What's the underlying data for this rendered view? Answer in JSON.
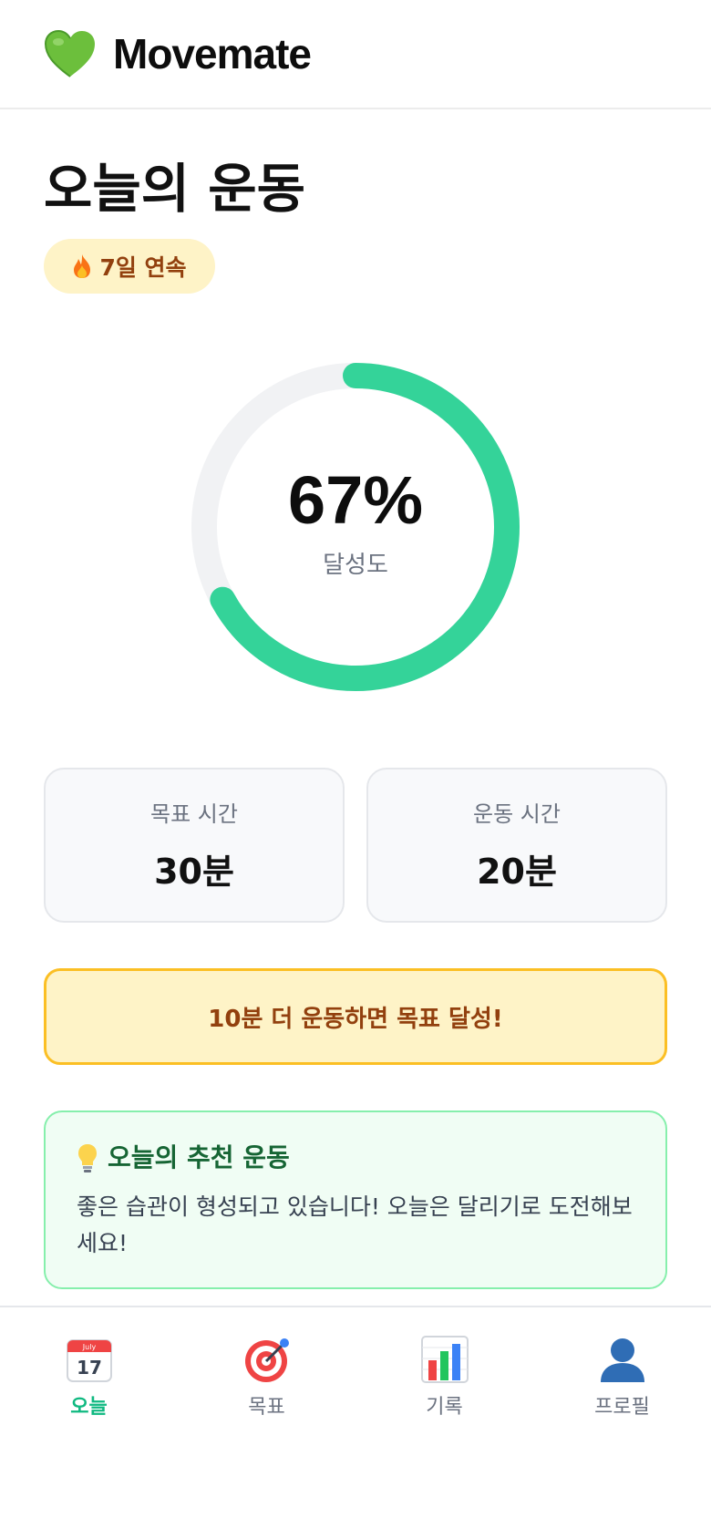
{
  "header": {
    "app_name": "Movemate",
    "brand_icon": "green-heart-icon",
    "brand_color": "#5fb234"
  },
  "main": {
    "title": "오늘의 운동",
    "streak": {
      "icon": "fire-icon",
      "label": "7일 연속"
    },
    "progress": {
      "value_text": "67%",
      "value": 0.67,
      "label": "달성도",
      "color": "#34d399",
      "track_color": "#f1f2f4"
    },
    "stats": [
      {
        "label": "목표 시간",
        "value": "30분"
      },
      {
        "label": "운동 시간",
        "value": "20분"
      }
    ],
    "notice": "10분 더 운동하면 목표 달성!",
    "tip": {
      "icon": "lightbulb-icon",
      "title": "오늘의 추천 운동",
      "text": "좋은 습관이 형성되고 있습니다! 오늘은 달리기로 도전해보세요!"
    }
  },
  "nav": {
    "active_color": "#10b981",
    "items": [
      {
        "label": "오늘",
        "icon": "calendar-icon",
        "icon_text": "17",
        "icon_header": "July",
        "active": true
      },
      {
        "label": "목표",
        "icon": "target-icon",
        "active": false
      },
      {
        "label": "기록",
        "icon": "bar-chart-icon",
        "active": false
      },
      {
        "label": "프로필",
        "icon": "user-icon",
        "active": false
      }
    ]
  }
}
